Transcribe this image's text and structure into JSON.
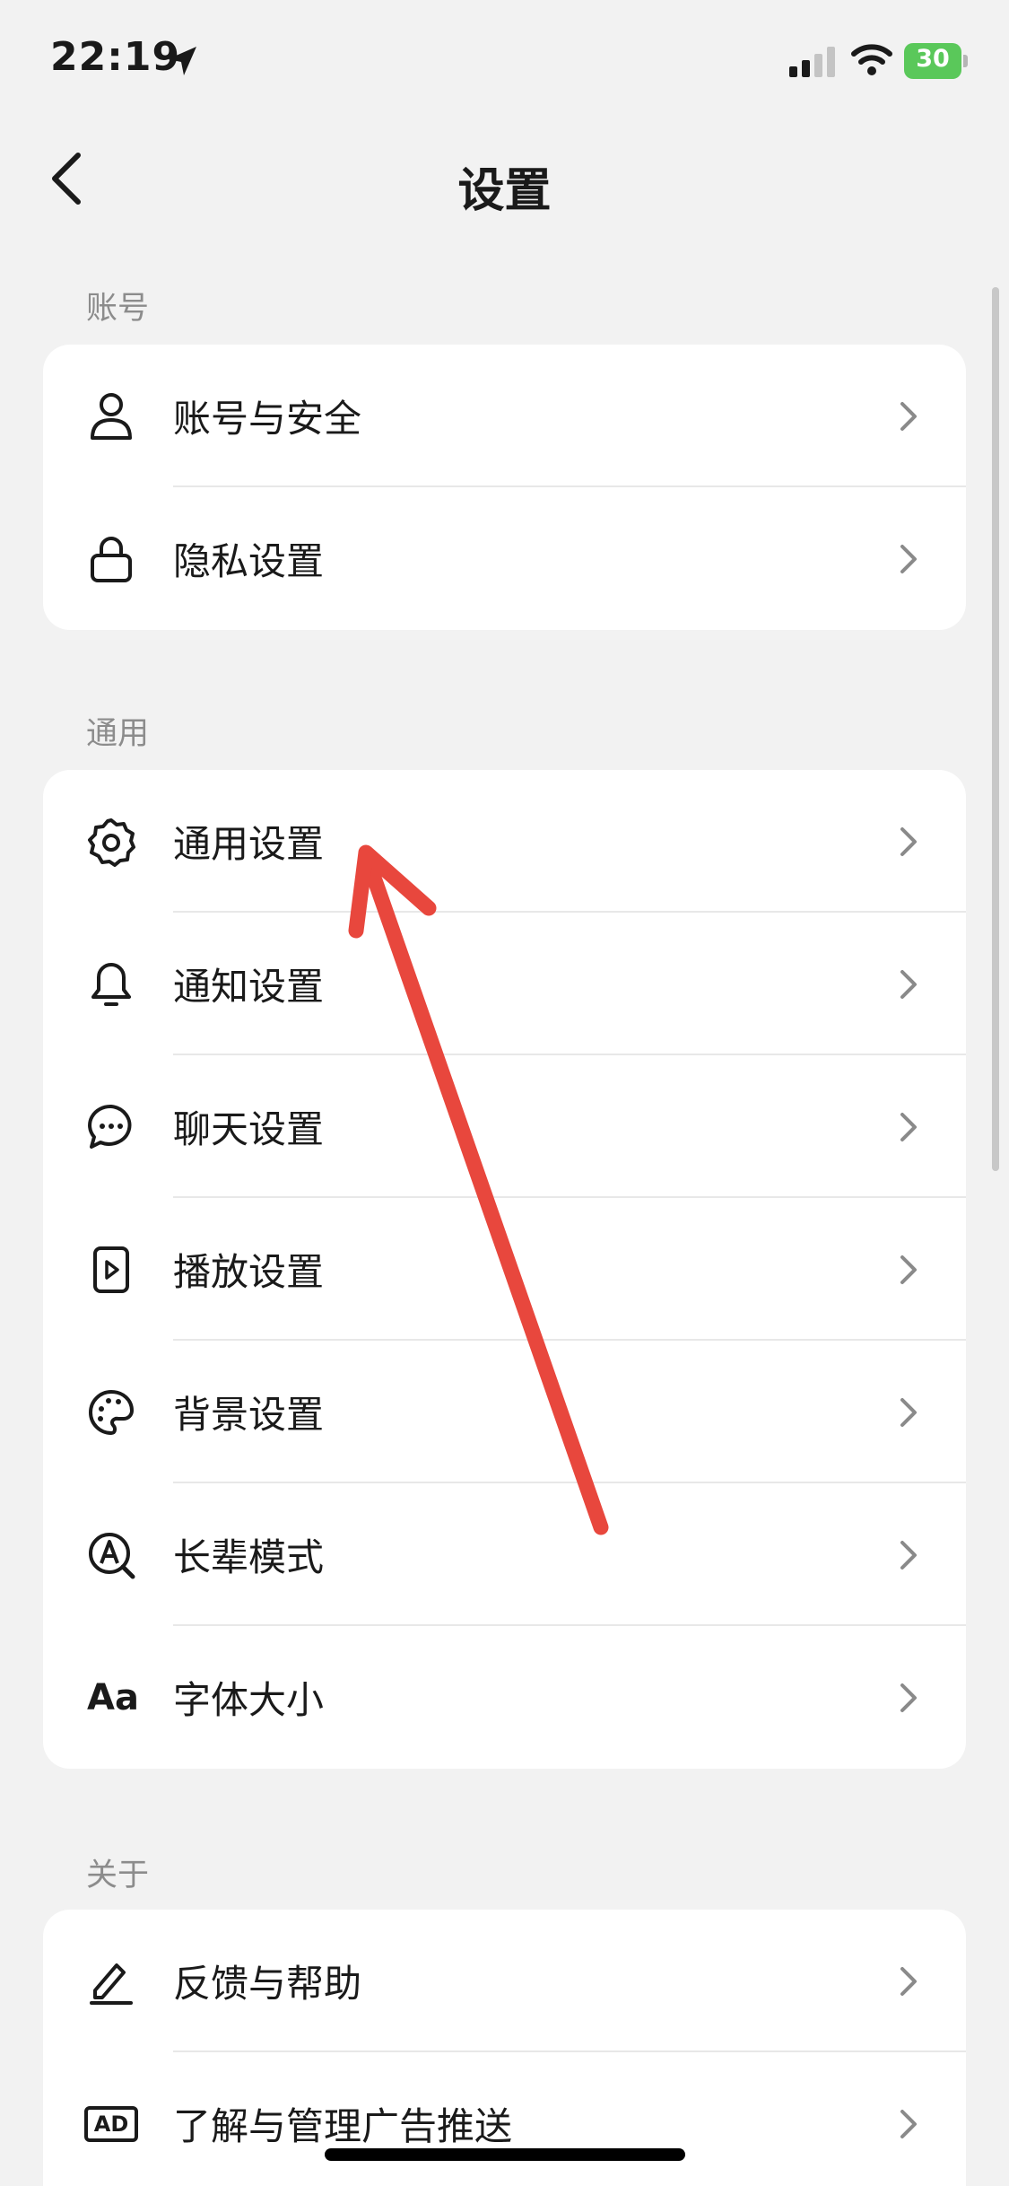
{
  "status_bar": {
    "time": "22:19",
    "battery": "30"
  },
  "nav": {
    "title": "设置"
  },
  "sections": {
    "account": {
      "label": "账号",
      "items": [
        {
          "label": "账号与安全",
          "icon": "person-icon"
        },
        {
          "label": "隐私设置",
          "icon": "lock-icon"
        }
      ]
    },
    "general": {
      "label": "通用",
      "items": [
        {
          "label": "通用设置",
          "icon": "gear-icon"
        },
        {
          "label": "通知设置",
          "icon": "bell-icon"
        },
        {
          "label": "聊天设置",
          "icon": "chat-bubble-icon"
        },
        {
          "label": "播放设置",
          "icon": "play-icon"
        },
        {
          "label": "背景设置",
          "icon": "palette-icon"
        },
        {
          "label": "长辈模式",
          "icon": "elder-mode-icon"
        },
        {
          "label": "字体大小",
          "icon": "font-size-icon",
          "icon_text": "Aa"
        }
      ]
    },
    "about": {
      "label": "关于",
      "items": [
        {
          "label": "反馈与帮助",
          "icon": "edit-pencil-icon"
        },
        {
          "label": "了解与管理广告推送",
          "icon": "ad-icon",
          "icon_text": "AD"
        }
      ]
    }
  },
  "colors": {
    "background": "#f2f2f2",
    "card": "#ffffff",
    "annotation": "#e8473d",
    "battery": "#5ac85a"
  }
}
